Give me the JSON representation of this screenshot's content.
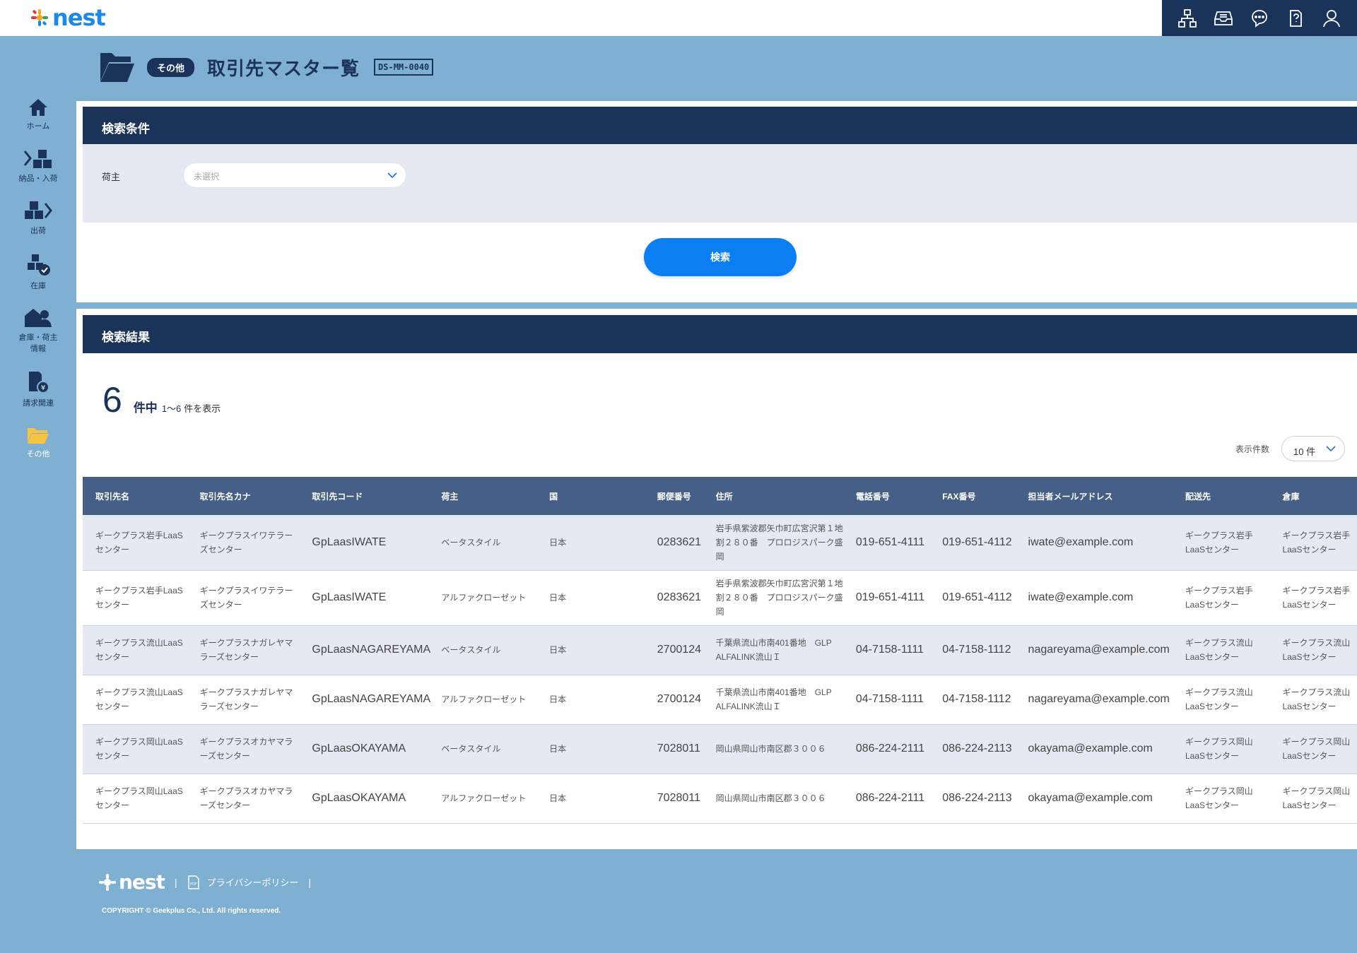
{
  "app": {
    "logo_text": "nest",
    "brand_color": "#1e88e5",
    "navy": "#1b3358"
  },
  "top_nav": [
    {
      "name": "sitemap-icon"
    },
    {
      "name": "inbox-icon"
    },
    {
      "name": "chat-icon"
    },
    {
      "name": "help-icon"
    },
    {
      "name": "user-icon"
    }
  ],
  "side_nav": {
    "home": "ホーム",
    "inbound": "納品・入荷",
    "outbound": "出荷",
    "stock": "在庫",
    "warehouse_line1": "倉庫・荷主",
    "warehouse_line2": "情報",
    "billing": "請求関連",
    "other": "その他"
  },
  "page": {
    "category": "その他",
    "title": "取引先マスター覧",
    "screen_code": "DS-MM-0040"
  },
  "search": {
    "header": "検索条件",
    "shipper_label": "荷主",
    "shipper_placeholder": "未選択",
    "button": "検索"
  },
  "results": {
    "header": "検索結果",
    "count": "6",
    "count_unit": "件中",
    "range": "1～6",
    "range_suffix": "件を表示",
    "perpage_label": "表示件数",
    "perpage_value": "10 件",
    "columns": [
      "取引先名",
      "取引先名カナ",
      "取引先コード",
      "荷主",
      "国",
      "郵便番号",
      "住所",
      "電話番号",
      "FAX番号",
      "担当者メールアドレス",
      "配送先",
      "倉庫"
    ],
    "rows": [
      {
        "name": "ギークプラス岩手LaaSセンター",
        "kana": "ギークプラスイワテラーズセンター",
        "code": "GpLaasIWATE",
        "shipper": "ベータスタイル",
        "country": "日本",
        "zip": "0283621",
        "address": "岩手県紫波郡矢巾町広宮沢第１地割２８０番　プロロジスパーク盛岡",
        "tel": "019-651-4111",
        "fax": "019-651-4112",
        "email": "iwate@example.com",
        "dest": "ギークプラス岩手LaaSセンター",
        "warehouse": "ギークプラス岩手LaaSセンター"
      },
      {
        "name": "ギークプラス岩手LaaSセンター",
        "kana": "ギークプラスイワテラーズセンター",
        "code": "GpLaasIWATE",
        "shipper": "アルファクローゼット",
        "country": "日本",
        "zip": "0283621",
        "address": "岩手県紫波郡矢巾町広宮沢第１地割２８０番　プロロジスパーク盛岡",
        "tel": "019-651-4111",
        "fax": "019-651-4112",
        "email": "iwate@example.com",
        "dest": "ギークプラス岩手LaaSセンター",
        "warehouse": "ギークプラス岩手LaaSセンター"
      },
      {
        "name": "ギークプラス流山LaaSセンター",
        "kana": "ギークプラスナガレヤマラーズセンター",
        "code": "GpLaasNAGAREYAMA",
        "shipper": "ベータスタイル",
        "country": "日本",
        "zip": "2700124",
        "address": "千葉県流山市南401番地　GLP ALFALINK流山Ｉ",
        "tel": "04-7158-1111",
        "fax": "04-7158-1112",
        "email": "nagareyama@example.com",
        "dest": "ギークプラス流山LaaSセンター",
        "warehouse": "ギークプラス流山LaaSセンター"
      },
      {
        "name": "ギークプラス流山LaaSセンター",
        "kana": "ギークプラスナガレヤマラーズセンター",
        "code": "GpLaasNAGAREYAMA",
        "shipper": "アルファクローゼット",
        "country": "日本",
        "zip": "2700124",
        "address": "千葉県流山市南401番地　GLP ALFALINK流山Ｉ",
        "tel": "04-7158-1111",
        "fax": "04-7158-1112",
        "email": "nagareyama@example.com",
        "dest": "ギークプラス流山LaaSセンター",
        "warehouse": "ギークプラス流山LaaSセンター"
      },
      {
        "name": "ギークプラス岡山LaaSセンター",
        "kana": "ギークプラスオカヤマラーズセンター",
        "code": "GpLaasOKAYAMA",
        "shipper": "ベータスタイル",
        "country": "日本",
        "zip": "7028011",
        "address": "岡山県岡山市南区郡３００６",
        "tel": "086-224-2111",
        "fax": "086-224-2113",
        "email": "okayama@example.com",
        "dest": "ギークプラス岡山LaaSセンター",
        "warehouse": "ギークプラス岡山LaaSセンター"
      },
      {
        "name": "ギークプラス岡山LaaSセンター",
        "kana": "ギークプラスオカヤマラーズセンター",
        "code": "GpLaasOKAYAMA",
        "shipper": "アルファクローゼット",
        "country": "日本",
        "zip": "7028011",
        "address": "岡山県岡山市南区郡３００６",
        "tel": "086-224-2111",
        "fax": "086-224-2113",
        "email": "okayama@example.com",
        "dest": "ギークプラス岡山LaaSセンター",
        "warehouse": "ギークプラス岡山LaaSセンター"
      }
    ]
  },
  "footer": {
    "logo_text": "nest",
    "separator": "|",
    "privacy": "プライバシーポリシー",
    "copyright": "COPYRIGHT © Geekplus Co., Ltd. All rights reserved."
  }
}
